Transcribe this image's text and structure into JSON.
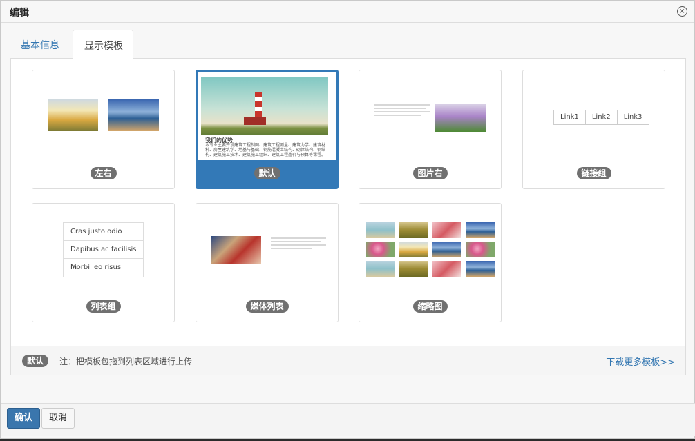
{
  "dialog": {
    "title": "编辑",
    "close_icon": "×"
  },
  "tabs": [
    {
      "label": "基本信息",
      "active": false
    },
    {
      "label": "显示模板",
      "active": true
    }
  ],
  "templates": [
    {
      "label": "左右",
      "selected": false
    },
    {
      "label": "默认",
      "selected": true
    },
    {
      "label": "图片右",
      "selected": false
    },
    {
      "label": "链接组",
      "selected": false
    },
    {
      "label": "列表组",
      "selected": false
    },
    {
      "label": "媒体列表",
      "selected": false
    },
    {
      "label": "缩略图",
      "selected": false
    }
  ],
  "default_preview": {
    "heading": "我们的优势",
    "text": "本专业主要开设建筑工程制图、建筑工程测量、建筑力学、建筑材料、房屋建筑学、地基与基础、钢筋混凝土结构、砌体结构、钢结构、建筑施工技术、建筑施工组织、建筑工程造价与预算等课程。"
  },
  "link_group": [
    "Link1",
    "Link2",
    "Link3"
  ],
  "list_group": [
    "Cras justo odio",
    "Dapibus ac facilisis in",
    "Morbi leo risus"
  ],
  "footer": {
    "badge": "默认",
    "note": "注：把模板包拖到列表区域进行上传",
    "more_link": "下载更多模板>>"
  },
  "buttons": {
    "ok": "确认",
    "cancel": "取消"
  },
  "colors": {
    "accent": "#3379b7",
    "link": "#3276b1",
    "badge": "#707070"
  }
}
